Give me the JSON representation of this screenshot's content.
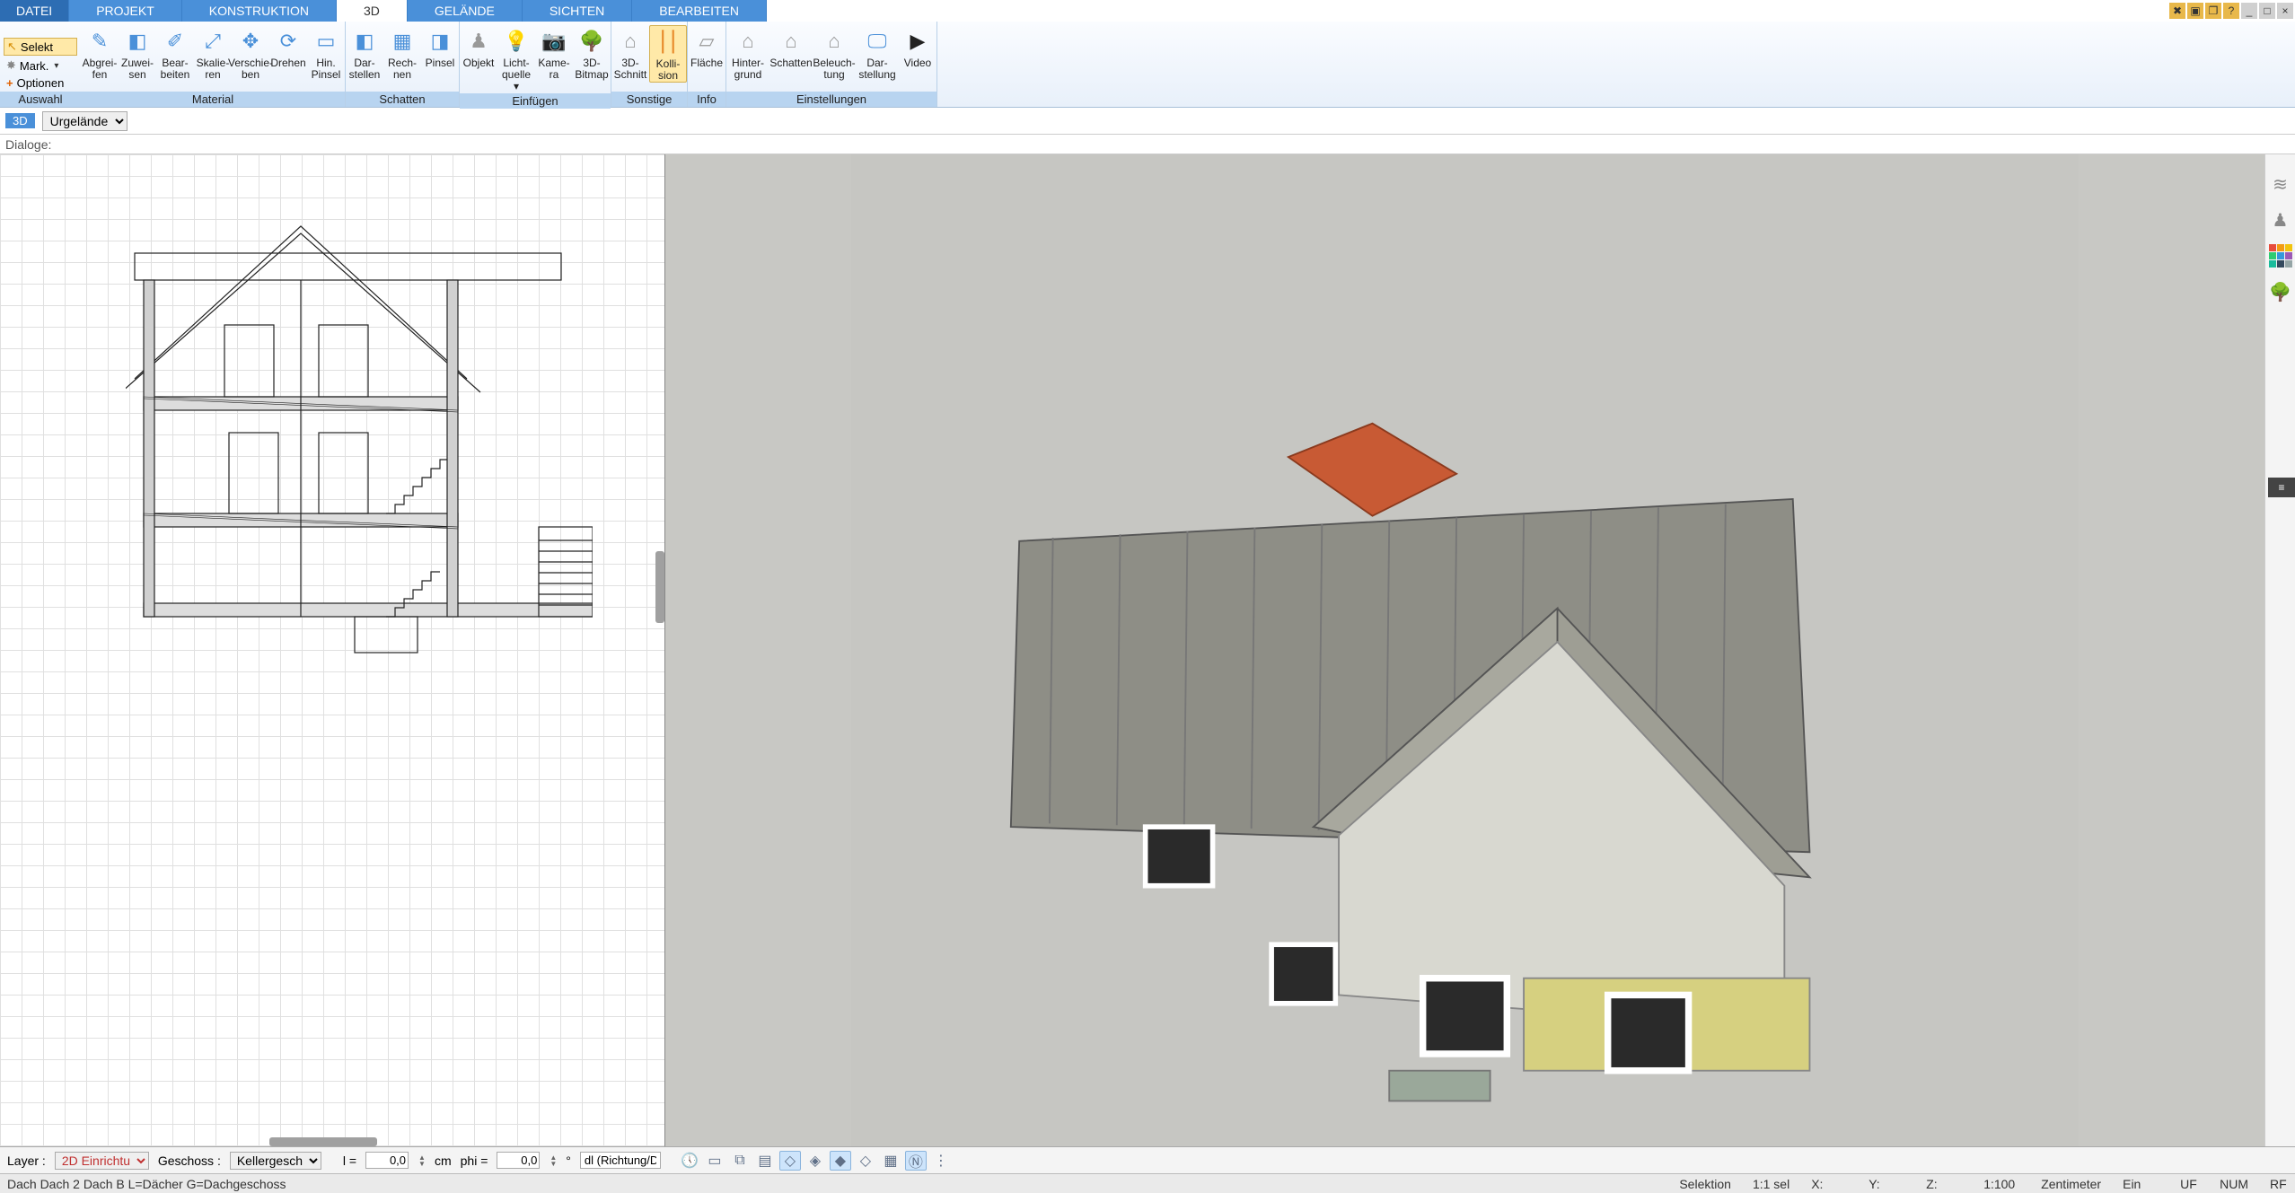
{
  "menu": {
    "tabs": [
      "DATEI",
      "PROJEKT",
      "KONSTRUKTION",
      "3D",
      "GELÄNDE",
      "SICHTEN",
      "BEARBEITEN"
    ],
    "active": "3D"
  },
  "ribbon_left": {
    "selekt": "Selekt",
    "mark": "Mark.",
    "optionen": "Optionen"
  },
  "ribbon": {
    "auswahl": {
      "label": "Auswahl"
    },
    "material": {
      "label": "Material",
      "tools": [
        {
          "id": "abgreifen",
          "l1": "Abgrei-",
          "l2": "fen"
        },
        {
          "id": "zuweisen",
          "l1": "Zuwei-",
          "l2": "sen"
        },
        {
          "id": "bearbeiten",
          "l1": "Bear-",
          "l2": "beiten"
        },
        {
          "id": "skalieren",
          "l1": "Skalie-",
          "l2": "ren"
        },
        {
          "id": "verschieben",
          "l1": "Verschie-",
          "l2": "ben"
        },
        {
          "id": "drehen",
          "l1": "Drehen",
          "l2": ""
        },
        {
          "id": "hinpinsel",
          "l1": "Hin.",
          "l2": "Pinsel"
        }
      ]
    },
    "schatten": {
      "label": "Schatten",
      "tools": [
        {
          "id": "darstellen",
          "l1": "Dar-",
          "l2": "stellen"
        },
        {
          "id": "rechnen",
          "l1": "Rech-",
          "l2": "nen"
        },
        {
          "id": "pinsel",
          "l1": "Pinsel",
          "l2": ""
        }
      ]
    },
    "einfuegen": {
      "label": "Einfügen",
      "tools": [
        {
          "id": "objekt",
          "l1": "Objekt",
          "l2": ""
        },
        {
          "id": "lichtquelle",
          "l1": "Licht-",
          "l2": "quelle ▾"
        },
        {
          "id": "kamera",
          "l1": "Kame-",
          "l2": "ra"
        },
        {
          "id": "bitmap",
          "l1": "3D-",
          "l2": "Bitmap"
        }
      ]
    },
    "sonstige": {
      "label": "Sonstige",
      "tools": [
        {
          "id": "schnitt",
          "l1": "3D-",
          "l2": "Schnitt"
        },
        {
          "id": "kollision",
          "l1": "Kolli-",
          "l2": "sion"
        }
      ]
    },
    "info": {
      "label": "Info",
      "tools": [
        {
          "id": "flaeche",
          "l1": "Fläche",
          "l2": ""
        }
      ]
    },
    "einstellungen": {
      "label": "Einstellungen",
      "tools": [
        {
          "id": "hintergrund",
          "l1": "Hinter-",
          "l2": "grund"
        },
        {
          "id": "schatten2",
          "l1": "Schatten",
          "l2": ""
        },
        {
          "id": "beleuchtung",
          "l1": "Beleuch-",
          "l2": "tung"
        },
        {
          "id": "darstellung",
          "l1": "Dar-",
          "l2": "stellung"
        },
        {
          "id": "video",
          "l1": "Video",
          "l2": ""
        }
      ]
    }
  },
  "subbar": {
    "mode": "3D",
    "terrain": "Urgelände"
  },
  "dialogbar": {
    "label": "Dialoge:"
  },
  "bottombar": {
    "layer_label": "Layer :",
    "layer_value": "2D Einrichtu",
    "geschoss_label": "Geschoss :",
    "geschoss_value": "Kellergesch",
    "l_label": "l =",
    "l_value": "0,0",
    "l_unit": "cm",
    "phi_label": "phi =",
    "phi_value": "0,0",
    "phi_unit": "°",
    "dl_value": "dl (Richtung/Di"
  },
  "status": {
    "left": "Dach Dach 2 Dach B L=Dächer G=Dachgeschoss",
    "selektion": "Selektion",
    "sel": "1:1 sel",
    "x": "X:",
    "y": "Y:",
    "z": "Z:",
    "scale": "1:100",
    "unit": "Zentimeter",
    "ein": "Ein",
    "uf": "UF",
    "num": "NUM",
    "rf": "RF"
  }
}
